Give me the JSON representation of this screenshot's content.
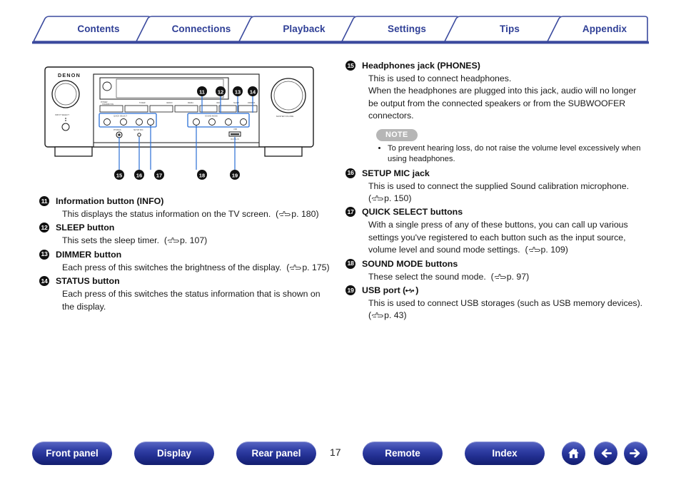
{
  "tabs": [
    {
      "label": "Contents",
      "name": "tab-contents"
    },
    {
      "label": "Connections",
      "name": "tab-connections"
    },
    {
      "label": "Playback",
      "name": "tab-playback"
    },
    {
      "label": "Settings",
      "name": "tab-settings"
    },
    {
      "label": "Tips",
      "name": "tab-tips"
    },
    {
      "label": "Appendix",
      "name": "tab-appendix"
    }
  ],
  "diagram": {
    "brand": "DENON",
    "alt": "Front panel of DENON AV receiver with callouts 11 through 19",
    "callouts": [
      "11",
      "12",
      "13",
      "14",
      "15",
      "16",
      "17",
      "18",
      "19"
    ],
    "labels": {
      "input_selector": "INPUT SELECTOR",
      "master_volume": "MASTER VOLUME",
      "quick_select": "QUICK SELECT",
      "sound_mode": "SOUND MODE",
      "phones": "PHONES",
      "setup_mic": "SETUP MIC",
      "usb": "USB"
    }
  },
  "left_items": [
    {
      "num": "11",
      "title": "Information button (INFO)",
      "body_before": "This displays the status information on the TV screen.",
      "page_ref": "p. 180",
      "body_after": ""
    },
    {
      "num": "12",
      "title": "SLEEP button",
      "body_before": "This sets the sleep timer.",
      "page_ref": "p. 107",
      "body_after": ""
    },
    {
      "num": "13",
      "title": "DIMMER button",
      "body_before": "Each press of this switches the brightness of the display.",
      "page_ref": "p. 175",
      "body_after": ""
    },
    {
      "num": "14",
      "title": "STATUS button",
      "body_before": "Each press of this switches the status information that is shown on the display.",
      "page_ref": "",
      "body_after": ""
    }
  ],
  "right_items": [
    {
      "num": "15",
      "title": "Headphones jack (PHONES)",
      "lines": [
        "This is used to connect headphones.",
        "When the headphones are plugged into this jack, audio will no longer",
        "be output from the connected speakers or from the SUBWOOFER",
        "connectors."
      ],
      "note": {
        "badge": "NOTE",
        "items": [
          "To prevent hearing loss, do not raise the volume level excessively when using headphones."
        ]
      }
    },
    {
      "num": "16",
      "title": "SETUP MIC jack",
      "lines": [
        "This is used to connect the supplied Sound calibration microphone."
      ],
      "page_ref": "p. 150"
    },
    {
      "num": "17",
      "title": "QUICK SELECT buttons",
      "lines": [
        "With a single press of any of these buttons, you can call up various",
        "settings you've registered to each button such as the input source,",
        "volume level and sound mode settings."
      ],
      "page_ref": "p. 109",
      "ref_inline": true
    },
    {
      "num": "18",
      "title": "SOUND MODE buttons",
      "lines": [
        "These select the sound mode."
      ],
      "page_ref": "p. 97",
      "ref_inline": true
    },
    {
      "num": "19",
      "title": "USB port (USB)",
      "lines": [
        "This is used to connect USB storages (such as USB memory devices)."
      ],
      "page_ref": "p. 43"
    }
  ],
  "bottom": {
    "buttons": [
      {
        "label": "Front panel",
        "name": "front-panel-button"
      },
      {
        "label": "Display",
        "name": "display-button"
      },
      {
        "label": "Rear panel",
        "name": "rear-panel-button"
      },
      {
        "label": "Remote",
        "name": "remote-button"
      },
      {
        "label": "Index",
        "name": "index-button"
      }
    ],
    "icons": [
      {
        "name": "home-icon"
      },
      {
        "name": "back-arrow-icon"
      },
      {
        "name": "forward-arrow-icon"
      }
    ],
    "page_number": "17"
  },
  "colors": {
    "tab_blue": "#2f3f96",
    "pill_blue": "#222f92",
    "note_gray": "#b6b6b6",
    "callout_black": "#111111",
    "leader_blue": "#2a6fd6"
  }
}
